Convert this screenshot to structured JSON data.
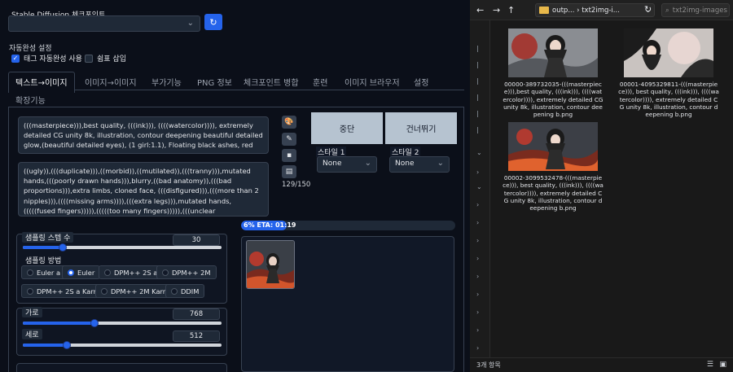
{
  "checkpoint": {
    "label": "Stable Diffusion 체크포인트",
    "value": ""
  },
  "autocomplete": {
    "title": "자동완성 설정",
    "tag_autocomplete": {
      "label": "태그 자동완성 사용",
      "checked": true
    },
    "comma_insert": {
      "label": "쉼표 삽입",
      "checked": false
    }
  },
  "tabs": [
    "텍스트→이미지",
    "이미지→이미지",
    "부가기능",
    "PNG 정보",
    "체크포인트 병합",
    "훈련",
    "이미지 브라우저",
    "설정",
    "확장기능"
  ],
  "active_tab": 0,
  "prompt": {
    "positive": "(((masterpiece))),best quality, (((ink))), ((((watercolor)))), extremely detailed CG unity 8k, illustration, contour deepening beautiful detailed glow,(beautiful detailed eyes), (1 girl:1.1), Floating black ashes, red moon, ((The black clouds)), (black Wings) , a black shadow in the pupils, ((disheveled hair)), black long hair, white hair, (((beautiful and detailed red eyes)))",
    "negative": "((ugly)),(((duplicate))),((morbid)),((mutilated)),(((tranny))),mutated hands,(((poorly drawn hands))),blurry,((bad anatomy)),(((bad proportions))),extra limbs, cloned face, (((disfigured))),(((more than 2 nipples))),((((missing arms)))),(((extra legs))),mutated hands,(((((fused fingers))))),(((((too many fingers))))),(((unclear eyes))),lowers, bad anatomy, bad hands, text, error, missing fingers, extra digit, fewer digits, cropped, worst quality, low quality, normal quality, jpeg artifacts, signature, watermark, username, blurry, bad feet",
    "token_count": "129/150"
  },
  "tools": [
    "palette-icon",
    "brush-icon",
    "save-icon",
    "clipboard-icon"
  ],
  "buttons": {
    "interrupt": "중단",
    "skip": "건너뛰기"
  },
  "styles": [
    {
      "label": "스타일 1",
      "value": "None"
    },
    {
      "label": "스타일 2",
      "value": "None"
    }
  ],
  "sampling_steps": {
    "label": "샘플링 스텝 수",
    "value": "30",
    "fraction": 0.2
  },
  "sampling_method": {
    "label": "샘플링 방법",
    "options": [
      "Euler a",
      "Euler",
      "DPM++ 2S a",
      "DPM++ 2M",
      "DPM++ 2S a Karras",
      "DPM++ 2M Karras",
      "DDIM"
    ],
    "selected": "Euler"
  },
  "width": {
    "label": "가로",
    "value": "768",
    "fraction": 0.36
  },
  "height": {
    "label": "세로",
    "value": "512",
    "fraction": 0.22
  },
  "progress": {
    "text": "6% ETA: 01:19",
    "fraction": 0.06
  },
  "explorer": {
    "address": "outp... › txt2img-i...",
    "search_placeholder": "txt2img-images ...",
    "files": [
      "00000-389732035-(((masterpiece))),best quality, (((ink))), ((((watercolor)))), extremely detailed CG unity 8k, illustration, contour deepening b.png",
      "00001-4095329811-(((masterpiece))), best quality, (((ink))), ((((watercolor)))), extremely detailed CG unity 8k, illustration, contour deepening b.png",
      "00002-3099532478-(((masterpiece))), best quality, (((ink))), ((((watercolor)))), extremely detailed CG unity 8k, illustration, contour deepening b.png"
    ],
    "status": "3개 항목"
  }
}
